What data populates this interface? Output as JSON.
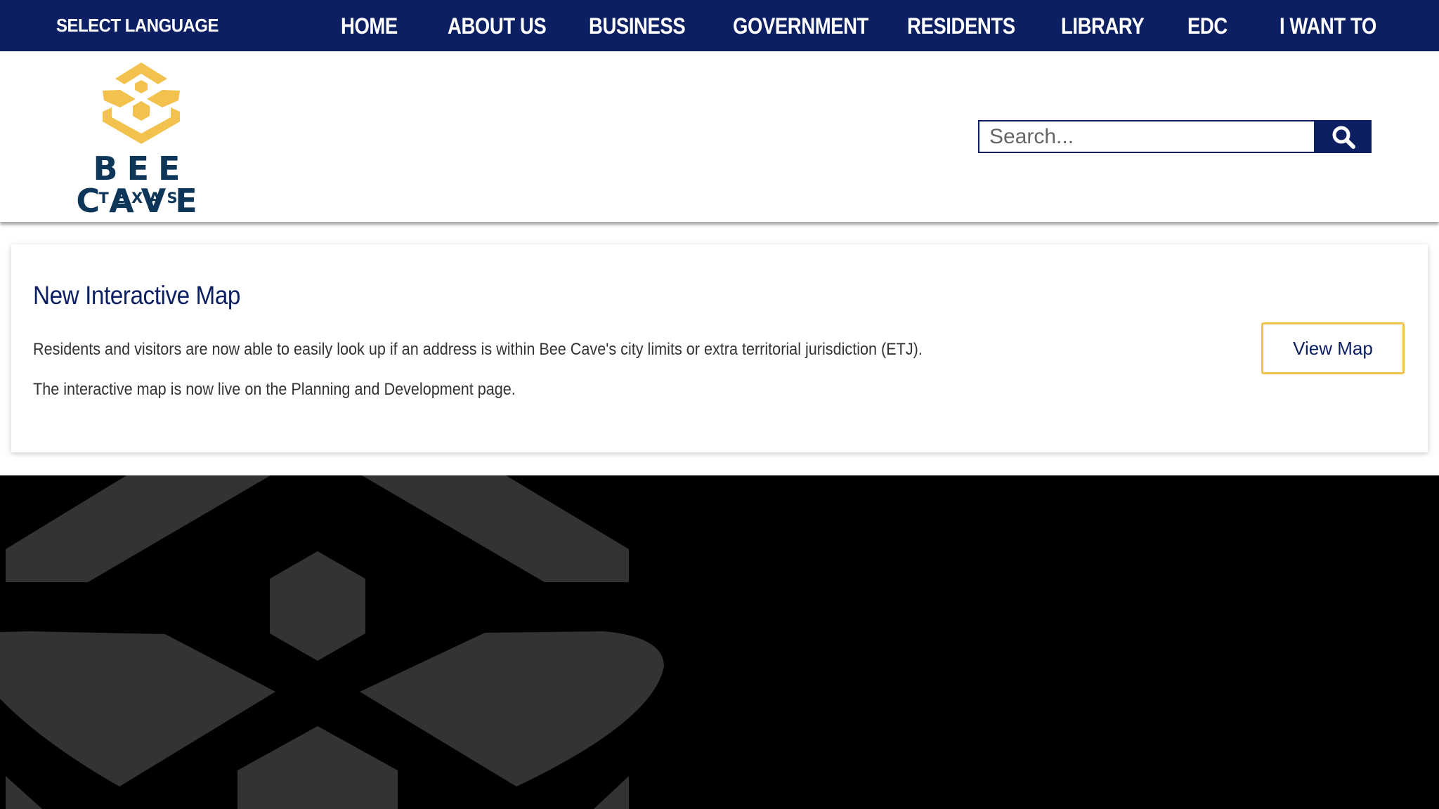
{
  "topbar": {
    "select_language": "SELECT LANGUAGE",
    "nav": [
      {
        "label": "HOME"
      },
      {
        "label": "ABOUT US"
      },
      {
        "label": "BUSINESS"
      },
      {
        "label": "GOVERNMENT"
      },
      {
        "label": "RESIDENTS"
      },
      {
        "label": "LIBRARY"
      },
      {
        "label": "EDC"
      },
      {
        "label": "I WANT TO"
      }
    ]
  },
  "header": {
    "logo_text": "BEE CAVE",
    "logo_subtext": "TEXAS",
    "search": {
      "placeholder": "Search...",
      "value": ""
    }
  },
  "notice": {
    "title": "New Interactive Map",
    "paragraphs": [
      "Residents and visitors are now able to easily look up if an address is within Bee Cave's city limits or extra territorial jurisdiction (ETJ).",
      "The interactive map is now live on the Planning and Development page."
    ],
    "button_label": "View Map"
  },
  "icons": {
    "search": "magnifying-glass",
    "logo_mark": "bee-hexagon",
    "footer_watermark": "bee-hexagon-watermark"
  },
  "colors": {
    "navy": "#0c1f63",
    "gold": "#f2c14e",
    "logo_text": "#0d3658",
    "watermark_gray": "#333333"
  }
}
